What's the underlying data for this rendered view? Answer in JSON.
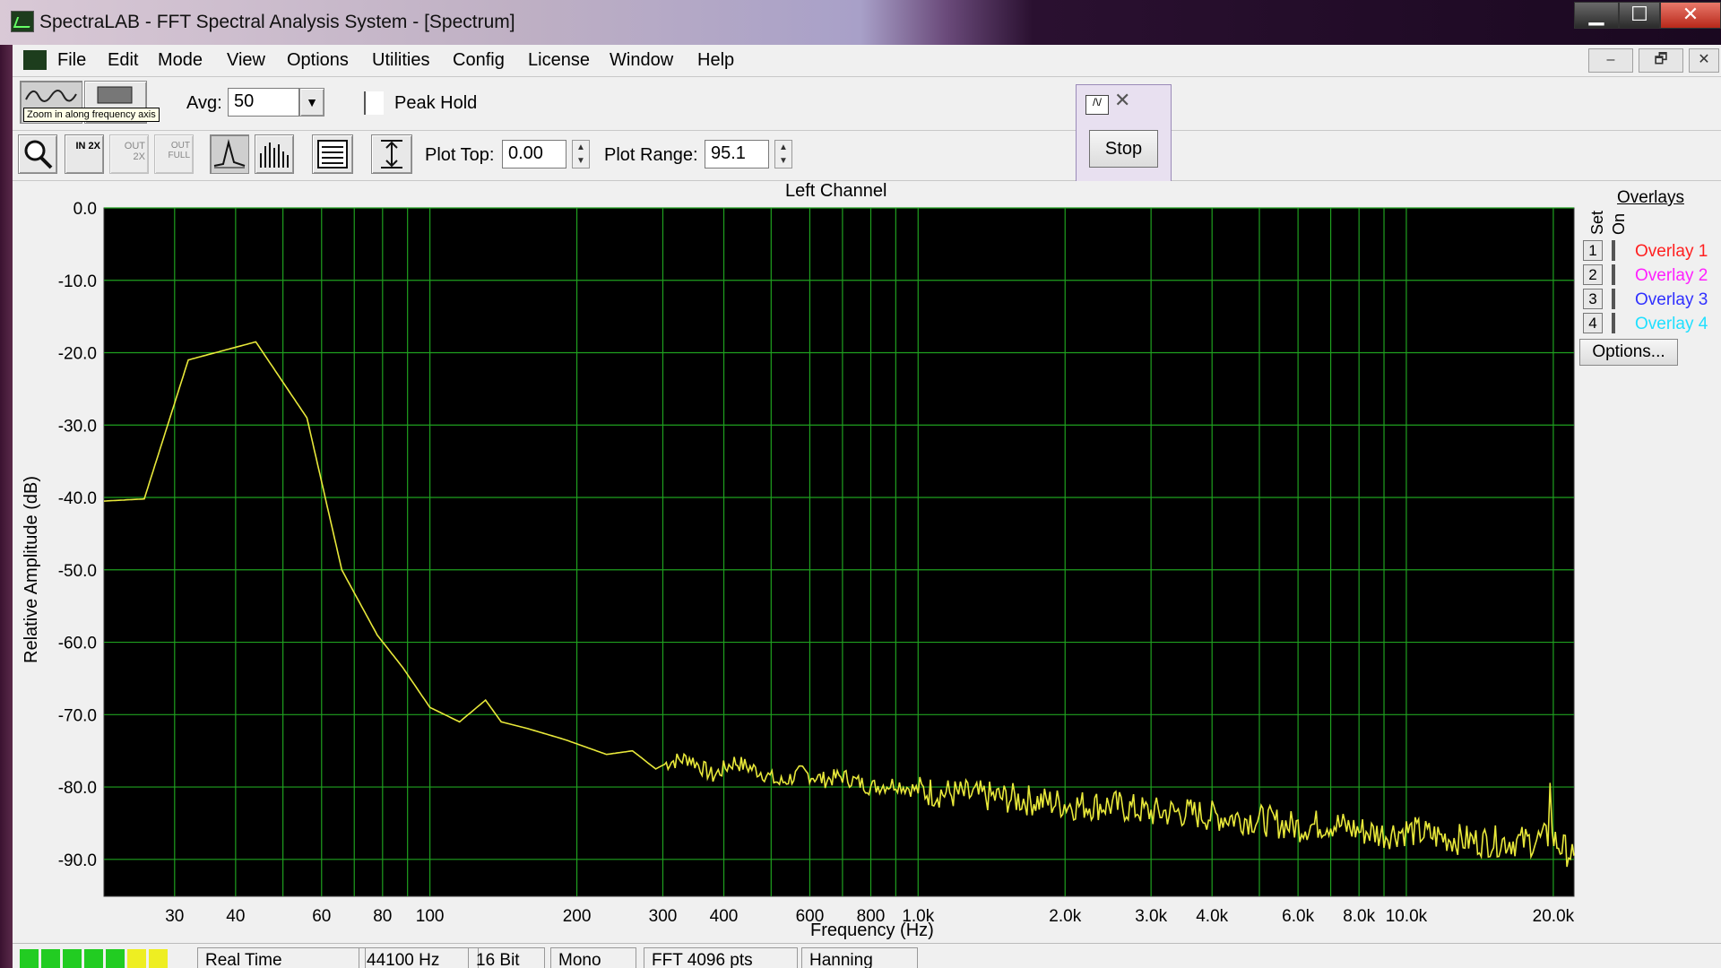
{
  "window": {
    "title": "SpectraLAB - FFT Spectral Analysis System - [Spectrum]",
    "min_label": "▁",
    "max_label": "☐",
    "close_label": "✕"
  },
  "menu": [
    "File",
    "Edit",
    "Mode",
    "View",
    "Options",
    "Utilities",
    "Config",
    "License",
    "Window",
    "Help"
  ],
  "mdi_buttons": [
    "–",
    "🗗",
    "✕"
  ],
  "toolbar": {
    "tooltip": "Zoom in along frequency axis",
    "avg_label": "Avg:",
    "avg_value": "50",
    "peak_hold_label": "Peak Hold",
    "plot_top_label": "Plot Top:",
    "plot_top_value": "0.00",
    "plot_range_label": "Plot Range:",
    "plot_range_value": "95.1",
    "zoom_in_2x_text": "IN 2X",
    "zoom_out_2x_text": "OUT 2X",
    "zoom_out_full_text": "OUT FULL"
  },
  "float_window": {
    "stop_label": "Stop",
    "close_label": "✕",
    "icon_text": "/\\/"
  },
  "plot": {
    "channel_title": "Left Channel",
    "ylabel": "Relative Amplitude (dB)",
    "xlabel": "Frequency (Hz)",
    "background": "#000000",
    "grid_color": "#1fa01f",
    "trace_color": "#e8e83a"
  },
  "chart_data": {
    "type": "line",
    "title": "Left Channel",
    "xlabel": "Frequency (Hz)",
    "ylabel": "Relative Amplitude (dB)",
    "x_scale": "log",
    "xlim": [
      21.5,
      22050
    ],
    "ylim": [
      -95.1,
      0
    ],
    "grid": true,
    "x_ticks": [
      {
        "value": 30,
        "label": "30"
      },
      {
        "value": 40,
        "label": "40"
      },
      {
        "value": 60,
        "label": "60"
      },
      {
        "value": 80,
        "label": "80"
      },
      {
        "value": 100,
        "label": "100"
      },
      {
        "value": 200,
        "label": "200"
      },
      {
        "value": 300,
        "label": "300"
      },
      {
        "value": 400,
        "label": "400"
      },
      {
        "value": 600,
        "label": "600"
      },
      {
        "value": 800,
        "label": "800"
      },
      {
        "value": 1000,
        "label": "1.0k"
      },
      {
        "value": 2000,
        "label": "2.0k"
      },
      {
        "value": 3000,
        "label": "3.0k"
      },
      {
        "value": 4000,
        "label": "4.0k"
      },
      {
        "value": 6000,
        "label": "6.0k"
      },
      {
        "value": 8000,
        "label": "8.0k"
      },
      {
        "value": 10000,
        "label": "10.0k"
      },
      {
        "value": 20000,
        "label": "20.0k"
      }
    ],
    "y_ticks": [
      {
        "value": 0,
        "label": "0.0"
      },
      {
        "value": -10,
        "label": "-10.0"
      },
      {
        "value": -20,
        "label": "-20.0"
      },
      {
        "value": -30,
        "label": "-30.0"
      },
      {
        "value": -40,
        "label": "-40.0"
      },
      {
        "value": -50,
        "label": "-50.0"
      },
      {
        "value": -60,
        "label": "-60.0"
      },
      {
        "value": -70,
        "label": "-70.0"
      },
      {
        "value": -80,
        "label": "-80.0"
      },
      {
        "value": -90,
        "label": "-90.0"
      }
    ],
    "series": [
      {
        "x": [
          21.5,
          26,
          32,
          44,
          56,
          66,
          78,
          88,
          100,
          115,
          130,
          140,
          160,
          190,
          230,
          260,
          290,
          310,
          340,
          380,
          420,
          480,
          520,
          580,
          640,
          700,
          800,
          900,
          1000,
          1200,
          1500,
          1800,
          2100,
          2500,
          3000,
          3500,
          4000,
          5000,
          6000,
          7000,
          8000,
          9000,
          10000,
          12000,
          14000,
          16000,
          18000,
          19500,
          19700,
          19900,
          20500,
          21500,
          22050
        ],
        "y": [
          -40.5,
          -40.2,
          -21,
          -18.5,
          -29,
          -50,
          -59,
          -63.5,
          -69,
          -71,
          -68,
          -71,
          -72,
          -73.5,
          -75.5,
          -75,
          -77.5,
          -76.5,
          -76,
          -78.5,
          -76.5,
          -78,
          -79.5,
          -78,
          -79,
          -78.5,
          -80,
          -79.5,
          -80.5,
          -81,
          -81.5,
          -82,
          -82.5,
          -82.5,
          -83.5,
          -83.5,
          -84,
          -84.5,
          -85.5,
          -85,
          -86,
          -86.5,
          -86,
          -87,
          -87.5,
          -87.5,
          -87.5,
          -87,
          -78,
          -87,
          -88,
          -89,
          -89.5
        ]
      }
    ]
  },
  "overlays": {
    "title": "Overlays",
    "set_label": "Set",
    "on_label": "On",
    "items": [
      {
        "num": "1",
        "name": "Overlay 1",
        "color": "#ff2020"
      },
      {
        "num": "2",
        "name": "Overlay 2",
        "color": "#ff20ff"
      },
      {
        "num": "3",
        "name": "Overlay 3",
        "color": "#3030ff"
      },
      {
        "num": "4",
        "name": "Overlay 4",
        "color": "#20e0ff"
      }
    ],
    "options_label": "Options..."
  },
  "status": {
    "meter_colors": [
      "#22cc22",
      "#22cc22",
      "#22cc22",
      "#22cc22",
      "#22cc22",
      "#eeee22",
      "#eeee22"
    ],
    "mode": "Real Time",
    "sample_rate": "44100 Hz",
    "bits": "16 Bit",
    "channels": "Mono",
    "fft": "FFT 4096 pts",
    "window_fn": "Hanning"
  }
}
